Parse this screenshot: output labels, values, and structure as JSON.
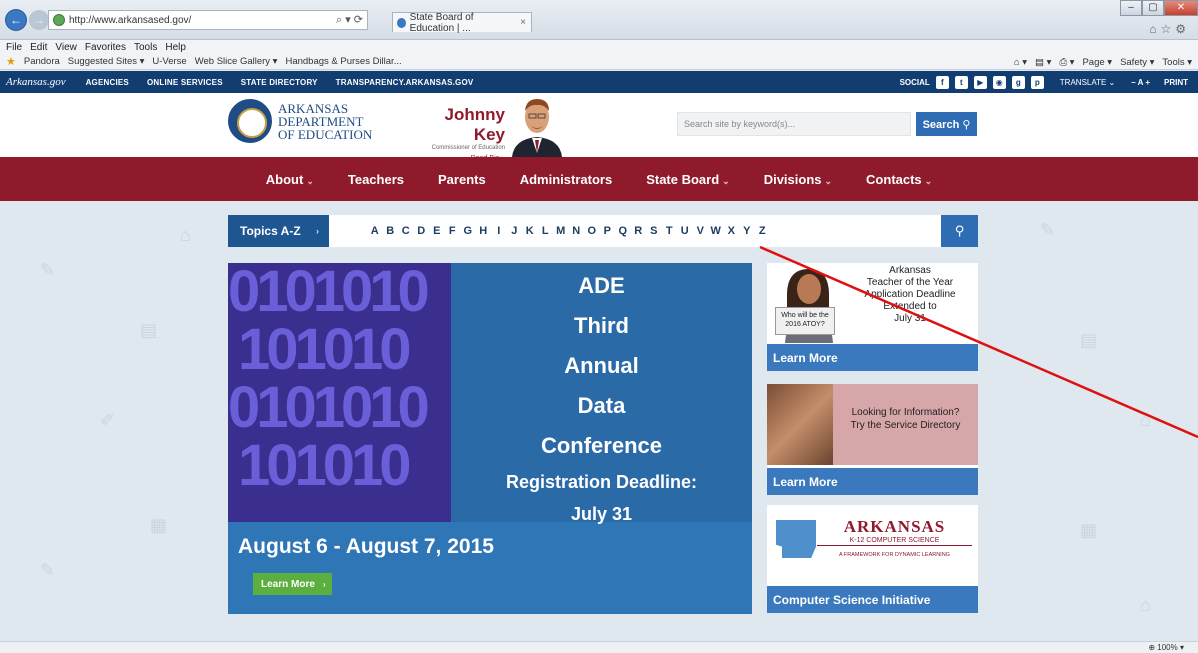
{
  "browser": {
    "url": "http://www.arkansased.gov/",
    "address_controls": "⌕ ▾ ⟳",
    "tab_title": "State Board of Education | ...",
    "tab_close": "×",
    "menu": [
      "File",
      "Edit",
      "View",
      "Favorites",
      "Tools",
      "Help"
    ],
    "favorites": [
      "Pandora",
      "Suggested Sites ▾",
      "U-Verse",
      "Web Slice Gallery ▾",
      "Handbags & Purses Dillar..."
    ],
    "command_bar": [
      "Page ▾",
      "Safety ▾",
      "Tools ▾"
    ],
    "zoom": "100%",
    "window_controls": [
      "–",
      "▢",
      "✕"
    ]
  },
  "govbar": {
    "logo": "Arkansas.gov",
    "links": [
      "AGENCIES",
      "ONLINE SERVICES",
      "STATE DIRECTORY",
      "TRANSPARENCY.ARKANSAS.GOV"
    ],
    "social_label": "SOCIAL",
    "social_icons": [
      "f",
      "t",
      "▶",
      "◉",
      "g",
      "p"
    ],
    "translate": "TRANSLATE ⌄",
    "font_size": "– A +",
    "print": "PRINT"
  },
  "header": {
    "logo_line1": "ARKANSAS",
    "logo_line2": "DEPARTMENT",
    "logo_line3": "OF EDUCATION",
    "commissioner_name": "Johnny Key",
    "commissioner_title": "Commissioner of Education",
    "read_bio": "Read Bio ▸",
    "search_placeholder": "Search site by keyword(s)...",
    "search_button": "Search ⚲"
  },
  "mainnav": [
    {
      "label": "About",
      "dropdown": "⌄"
    },
    {
      "label": "Teachers",
      "dropdown": ""
    },
    {
      "label": "Parents",
      "dropdown": ""
    },
    {
      "label": "Administrators",
      "dropdown": ""
    },
    {
      "label": "State Board",
      "dropdown": "⌄"
    },
    {
      "label": "Divisions",
      "dropdown": "⌄"
    },
    {
      "label": "Contacts",
      "dropdown": "⌄"
    }
  ],
  "topics": {
    "label": "Topics A-Z",
    "arrow": "›",
    "letters": [
      "A",
      "B",
      "C",
      "D",
      "E",
      "F",
      "G",
      "H",
      "I",
      "J",
      "K",
      "L",
      "M",
      "N",
      "O",
      "P",
      "Q",
      "R",
      "S",
      "T",
      "U",
      "V",
      "W",
      "X",
      "Y",
      "Z"
    ],
    "search_icon": "⚲"
  },
  "hero": {
    "binary": [
      "0101010",
      "101010",
      "0101010",
      "101010"
    ],
    "line1": "ADE",
    "line2": "Third",
    "line3": "Annual",
    "line4": "Data",
    "line5": "Conference",
    "deadline1": "Registration Deadline:",
    "deadline2": "July 31",
    "dates": "August 6 - August 7, 2015",
    "learn_more": "Learn More",
    "learn_arrow": "›"
  },
  "cards": {
    "toty": {
      "sign": "Who will be the 2016 ATOY?",
      "line1": "Arkansas",
      "line2": "Teacher of the Year",
      "line3": "Application Deadline",
      "line4": "Extended to",
      "line5": "July 31",
      "cta": "Learn More"
    },
    "service": {
      "line1": "Looking for Information?",
      "line2": "Try the Service Directory",
      "cta": "Learn More"
    },
    "cs": {
      "title": "ARKANSAS",
      "subtitle": "K-12 COMPUTER SCIENCE",
      "tagline": "A FRAMEWORK FOR DYNAMIC LEARNING",
      "cta": "Computer Science Initiative"
    }
  },
  "colors": {
    "navy": "#123d70",
    "maroon": "#8e1a2b",
    "blue": "#2e6db4",
    "green": "#5caf3e"
  }
}
